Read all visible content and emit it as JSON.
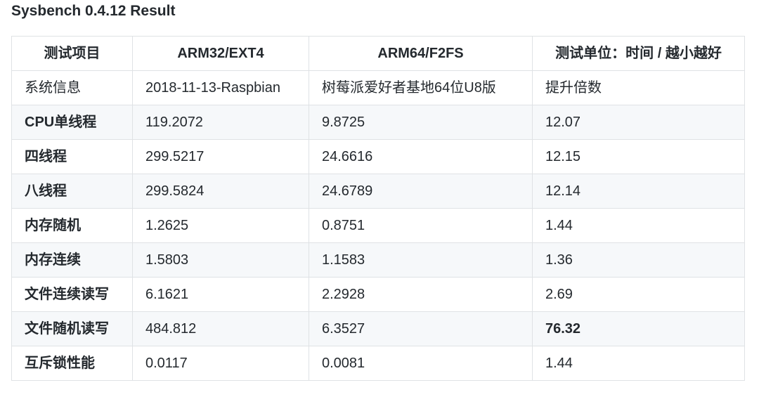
{
  "title": "Sysbench 0.4.12 Result",
  "table": {
    "headers": [
      "测试项目",
      "ARM32/EXT4",
      "ARM64/F2FS",
      "测试单位：时间 / 越小越好"
    ],
    "rows": [
      [
        "系统信息",
        "2018-11-13-Raspbian",
        "树莓派爱好者基地64位U8版",
        "提升倍数"
      ],
      [
        "CPU单线程",
        "119.2072",
        "9.8725",
        "12.07"
      ],
      [
        "四线程",
        "299.5217",
        "24.6616",
        "12.15"
      ],
      [
        "八线程",
        "299.5824",
        "24.6789",
        "12.14"
      ],
      [
        "内存随机",
        "1.2625",
        "0.8751",
        "1.44"
      ],
      [
        "内存连续",
        "1.5803",
        "1.1583",
        "1.36"
      ],
      [
        "文件连续读写",
        "6.1621",
        "2.2928",
        "2.69"
      ],
      [
        "文件随机读写",
        "484.812",
        "6.3527",
        "76.32"
      ],
      [
        "互斥锁性能",
        "0.0117",
        "0.0081",
        "1.44"
      ]
    ]
  },
  "colors": {
    "text": "#24292e",
    "border": "#dfe2e5",
    "stripe": "#f6f8fa"
  }
}
